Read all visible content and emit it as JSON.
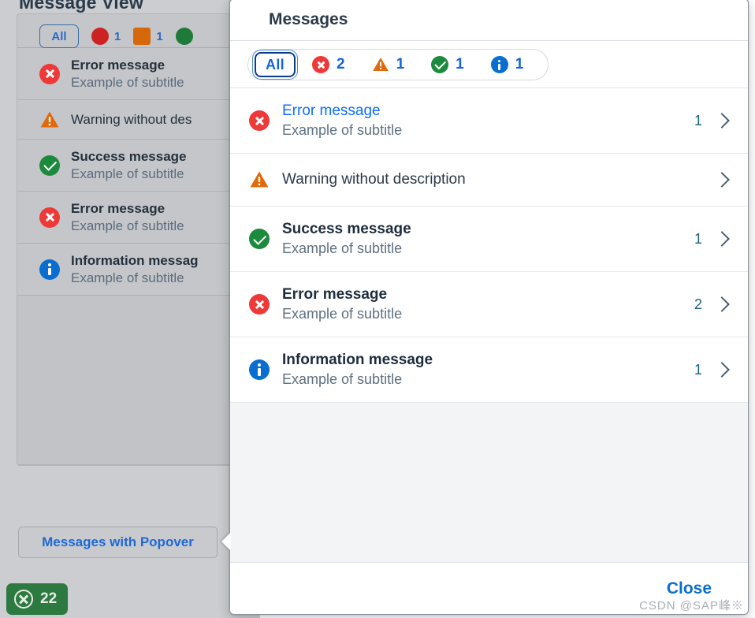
{
  "background": {
    "page_title": "Message View",
    "filter_bar": {
      "all_label": "All",
      "counts": [
        "1",
        "1"
      ]
    },
    "messages": [
      {
        "type": "error",
        "title": "Error message",
        "subtitle": "Example of subtitle"
      },
      {
        "type": "warning",
        "title": "Warning without des",
        "subtitle": ""
      },
      {
        "type": "success",
        "title": "Success message",
        "subtitle": "Example of subtitle"
      },
      {
        "type": "error",
        "title": "Error message",
        "subtitle": "Example of subtitle"
      },
      {
        "type": "info",
        "title": "Information messag",
        "subtitle": "Example of subtitle"
      }
    ],
    "popover_button_label": "Messages with Popover",
    "badge": {
      "label": "22",
      "icon": "close-circle-icon",
      "color": "#2c7a3f"
    }
  },
  "popover": {
    "title": "Messages",
    "filter": {
      "all_label": "All",
      "items": [
        {
          "icon": "error-icon",
          "count": "2"
        },
        {
          "icon": "warning-icon",
          "count": "1"
        },
        {
          "icon": "success-icon",
          "count": "1"
        },
        {
          "icon": "info-icon",
          "count": "1"
        }
      ]
    },
    "messages": [
      {
        "type": "error",
        "icon": "error-icon",
        "title": "Error message",
        "title_style": "link",
        "subtitle": "Example of subtitle",
        "count": "1",
        "chevron": "chevron-right-icon"
      },
      {
        "type": "warning",
        "icon": "warning-icon",
        "title": "Warning without description",
        "title_style": "plain",
        "subtitle": "",
        "count": "",
        "chevron": "chevron-right-icon"
      },
      {
        "type": "success",
        "icon": "success-icon",
        "title": "Success message",
        "title_style": "bold",
        "subtitle": "Example of subtitle",
        "count": "1",
        "chevron": "chevron-right-icon"
      },
      {
        "type": "error",
        "icon": "error-icon",
        "title": "Error message",
        "title_style": "bold",
        "subtitle": "Example of subtitle",
        "count": "2",
        "chevron": "chevron-right-icon"
      },
      {
        "type": "info",
        "icon": "info-icon",
        "title": "Information message",
        "title_style": "bold",
        "subtitle": "Example of subtitle",
        "count": "1",
        "chevron": "chevron-right-icon"
      }
    ],
    "footer": {
      "close_label": "Close"
    }
  },
  "watermark": "CSDN @SAP峰※",
  "colors": {
    "error": "#ee3939",
    "warning": "#e1690a",
    "success": "#1c8a3c",
    "info": "#0a6ed1",
    "link": "#0a6ed1",
    "count": "#19647e",
    "focus_outline": "#0a3a8c"
  }
}
